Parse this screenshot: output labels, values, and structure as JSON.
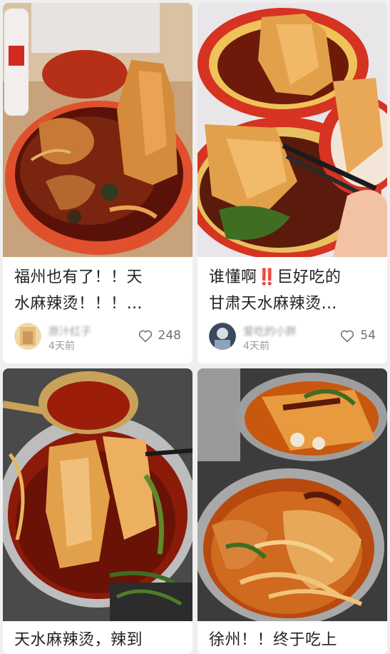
{
  "feed": {
    "cards": [
      {
        "title_lines": [
          "福州也有了！！天",
          "水麻辣烫！！！…"
        ],
        "author": "原汁红子",
        "time": "4天前",
        "likes": "248",
        "avatar_color": "#e8c27a",
        "image_icon": "food-photo-icon"
      },
      {
        "title_lines": [
          "谁懂啊‼️巨好吃的",
          "甘肃天水麻辣烫…"
        ],
        "author": "爱吃的小胖",
        "time": "4天前",
        "likes": "54",
        "avatar_color": "#4a6a8a",
        "image_icon": "food-photo-icon"
      },
      {
        "title_lines": [
          "天水麻辣烫，辣到"
        ],
        "image_icon": "food-photo-icon"
      },
      {
        "title_lines": [
          "徐州！！终于吃上"
        ],
        "image_icon": "food-photo-icon"
      }
    ]
  },
  "colors": {
    "background": "#efefef",
    "card": "#ffffff",
    "text": "#222222",
    "muted": "#9a9a9a",
    "broth": "#8e1c0c",
    "noodle": "#e3a04a"
  }
}
